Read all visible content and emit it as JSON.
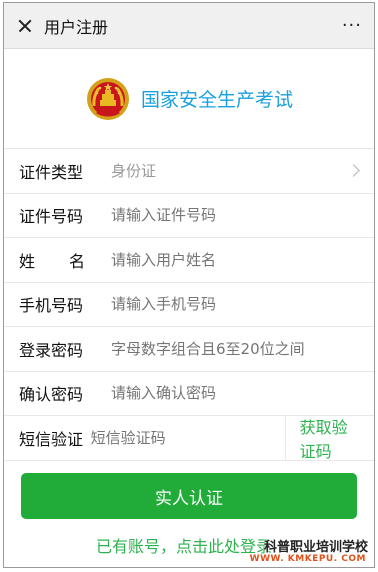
{
  "navbar": {
    "title": "用户注册",
    "close_icon": "close-icon",
    "more_icon": "more-dots-icon",
    "more_glyph": "···"
  },
  "brand": {
    "emblem_icon": "national-emblem-icon",
    "name": "国家安全生产考试",
    "color": "#1aa0e0"
  },
  "form": {
    "id_type": {
      "label": "证件类型",
      "value": "身份证"
    },
    "id_number": {
      "label": "证件号码",
      "placeholder": "请输入证件号码"
    },
    "name": {
      "label_first": "姓",
      "label_second": "名",
      "placeholder": "请输入用户姓名"
    },
    "phone": {
      "label": "手机号码",
      "placeholder": "请输入手机号码"
    },
    "password": {
      "label": "登录密码",
      "placeholder": "字母数字组合且6至20位之间"
    },
    "confirm_password": {
      "label": "确认密码",
      "placeholder": "请输入确认密码"
    },
    "sms": {
      "label": "短信验证",
      "placeholder": "短信验证码",
      "button": "获取验证码"
    }
  },
  "submit": {
    "label": "实人认证",
    "color": "#21ab38"
  },
  "login_link": "已有账号，点击此处登录",
  "watermark": {
    "title": "科普职业培训学校",
    "url": "WWW. KMKEPU. COM"
  }
}
